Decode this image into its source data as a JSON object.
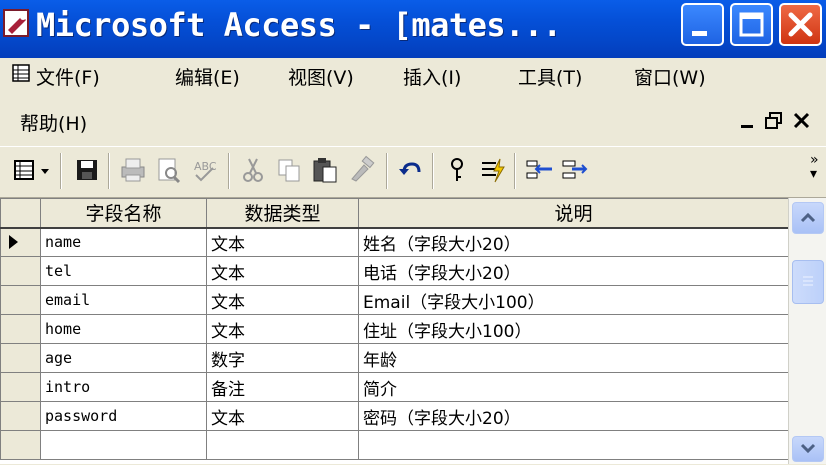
{
  "window": {
    "title": "Microsoft Access - [mates...",
    "icon": "access-key-icon",
    "controls": [
      "minimize-icon",
      "maximize-icon",
      "close-icon"
    ]
  },
  "menu": {
    "items": [
      "文件(F)",
      "编辑(E)",
      "视图(V)",
      "插入(I)",
      "工具(T)",
      "窗口(W)",
      "帮助(H)"
    ]
  },
  "mdi_controls": [
    "_",
    "▫",
    "×"
  ],
  "toolbar": {
    "buttons": [
      "view-icon",
      "dropdown-arrow-icon",
      "save-icon",
      "print-icon",
      "print-preview-icon",
      "spelling-icon",
      "cut-icon",
      "copy-icon",
      "paste-icon",
      "format-painter-icon",
      "undo-icon",
      "primary-key-icon",
      "indexes-icon",
      "insert-rows-icon",
      "delete-rows-icon",
      "overflow-icon"
    ]
  },
  "grid": {
    "columns": [
      "字段名称",
      "数据类型",
      "说明"
    ],
    "rows": [
      {
        "name": "name",
        "type": "文本",
        "desc": "姓名（字段大小20）"
      },
      {
        "name": "tel",
        "type": "文本",
        "desc": "电话（字段大小20）"
      },
      {
        "name": "email",
        "type": "文本",
        "desc": "Email（字段大小100）"
      },
      {
        "name": "home",
        "type": "文本",
        "desc": "住址（字段大小100）"
      },
      {
        "name": "age",
        "type": "数字",
        "desc": "年龄"
      },
      {
        "name": "intro",
        "type": "备注",
        "desc": "简介"
      },
      {
        "name": "password",
        "type": "文本",
        "desc": "密码（字段大小20）"
      },
      {
        "name": "",
        "type": "",
        "desc": ""
      }
    ],
    "current_row": 0
  },
  "colors": {
    "titlebar": "#0550d8",
    "close_button": "#e04b24",
    "chrome": "#ece9d8"
  }
}
